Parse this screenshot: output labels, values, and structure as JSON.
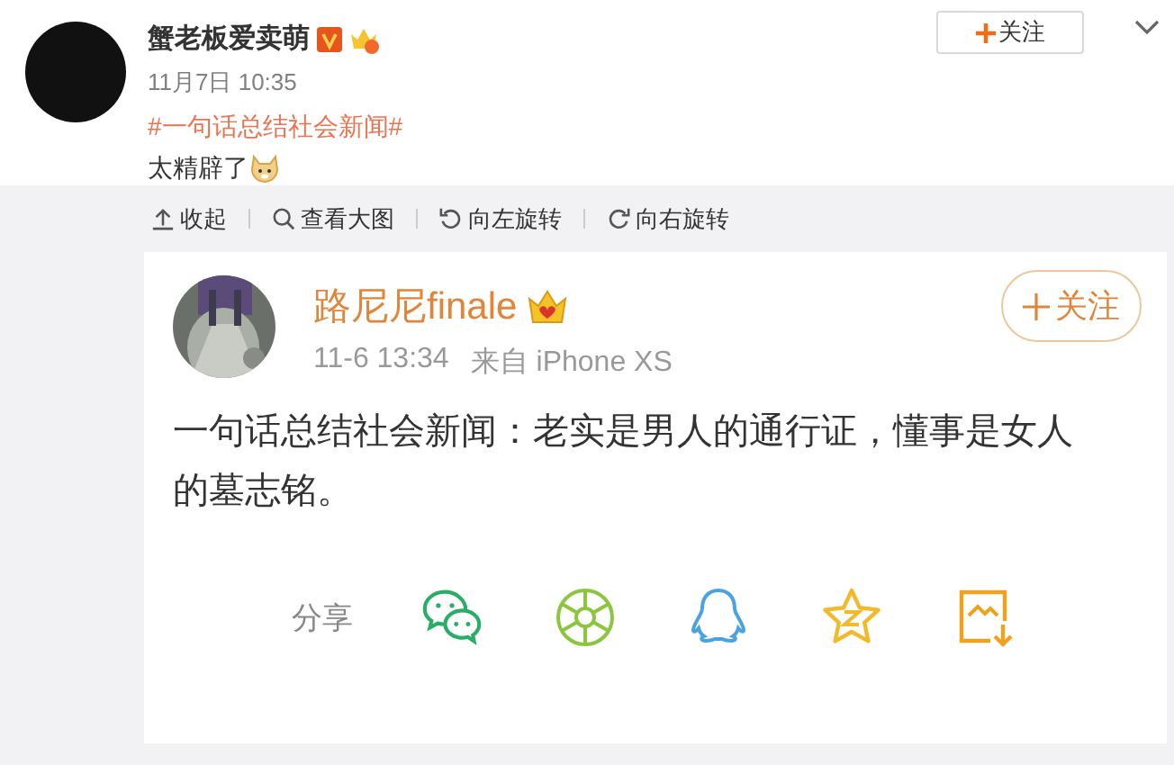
{
  "post": {
    "author": "蟹老板爱卖萌",
    "verified": true,
    "date": "11月7日 10:35",
    "hashtag": "#一句话总结社会新闻#",
    "text": "太精辟了",
    "follow_button": "关注"
  },
  "toolbar": [
    {
      "kind": "collapse",
      "label": "收起"
    },
    {
      "kind": "zoom",
      "label": "查看大图"
    },
    {
      "kind": "rotate_left",
      "label": "向左旋转"
    },
    {
      "kind": "rotate_right",
      "label": "向右旋转"
    }
  ],
  "shared_post": {
    "author": "路尼尼finale",
    "time": "11-6 13:34",
    "source": "来自 iPhone XS",
    "follow_button": "关注",
    "text": "一句话总结社会新闻：老实是男人的通行证，懂事是女人的墓志铭。",
    "share_label": "分享",
    "share_targets": [
      {
        "kind": "chat"
      },
      {
        "kind": "aperture"
      },
      {
        "kind": "penguin"
      },
      {
        "kind": "star"
      },
      {
        "kind": "save"
      }
    ]
  }
}
